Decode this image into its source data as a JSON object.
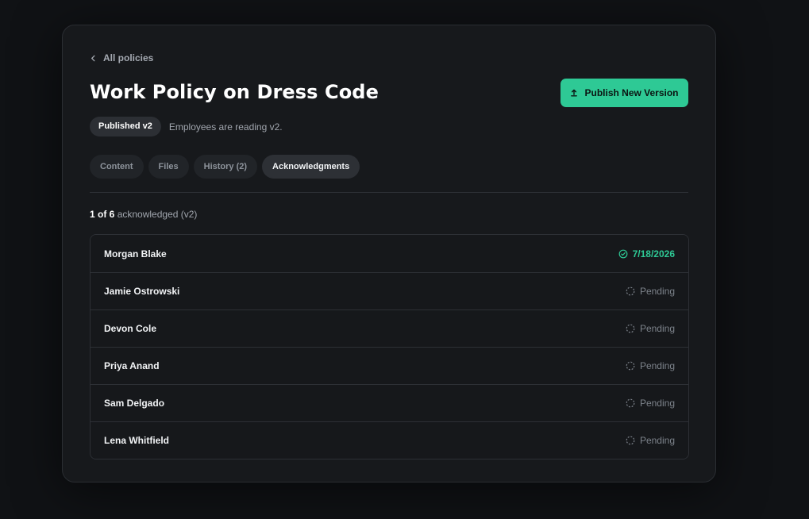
{
  "nav": {
    "back_label": "All policies"
  },
  "header": {
    "title": "Work Policy on Dress Code",
    "publish_label": "Publish New Version",
    "status_badge": "Published v2",
    "status_text": "Employees are reading v2."
  },
  "tabs": [
    {
      "label": "Content",
      "active": false
    },
    {
      "label": "Files",
      "active": false
    },
    {
      "label": "History (2)",
      "active": false
    },
    {
      "label": "Acknowledgments",
      "active": true
    }
  ],
  "summary": {
    "count": "1 of 6",
    "suffix": "acknowledged (v2)"
  },
  "acknowledgments": [
    {
      "name": "Morgan Blake",
      "status": "7/18/2026",
      "state": "done"
    },
    {
      "name": "Jamie Ostrowski",
      "status": "Pending",
      "state": "pending"
    },
    {
      "name": "Devon Cole",
      "status": "Pending",
      "state": "pending"
    },
    {
      "name": "Priya Anand",
      "status": "Pending",
      "state": "pending"
    },
    {
      "name": "Sam Delgado",
      "status": "Pending",
      "state": "pending"
    },
    {
      "name": "Lena Whitfield",
      "status": "Pending",
      "state": "pending"
    }
  ],
  "colors": {
    "accent": "#2ec995",
    "background": "#101215",
    "card": "#17191c"
  }
}
